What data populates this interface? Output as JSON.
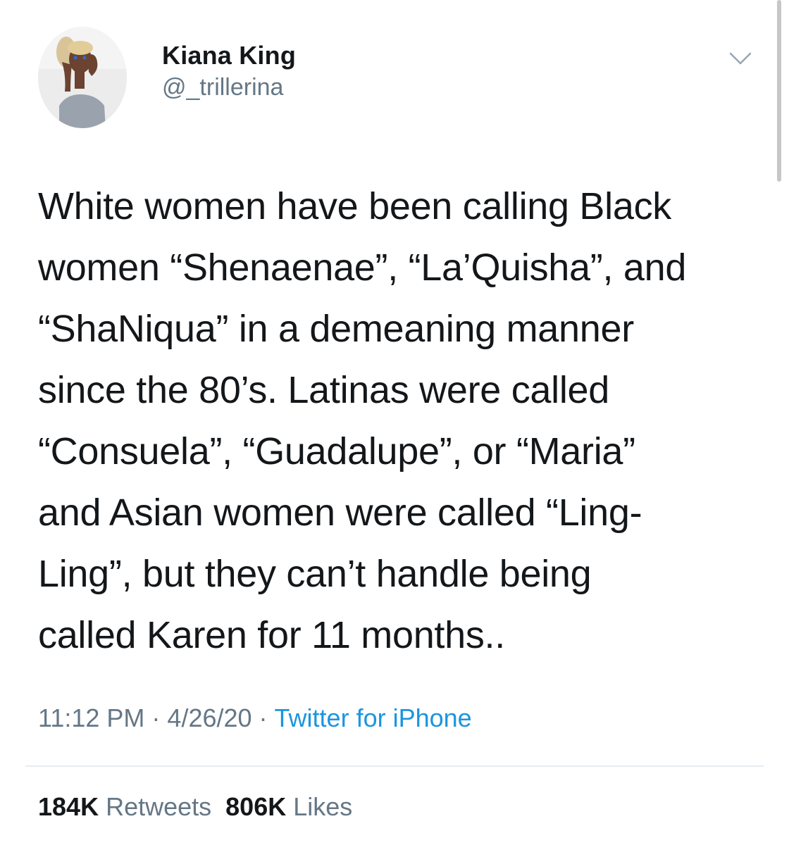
{
  "tweet": {
    "author": {
      "display_name": "Kiana King",
      "handle": "@_trillerina"
    },
    "text": "White women have been calling Black\nwomen “Shenaenae”, “La’Quisha”, and\n“ShaNiqua” in a demeaning manner\nsince the 80’s. Latinas were called\n“Consuela”, “Guadalupe”, or “Maria”\nand Asian women were called “Ling-\nLing”, but they can’t handle being\ncalled Karen for 11 months..",
    "time": "11:12 PM",
    "date": "4/26/20",
    "separator": "·",
    "source": "Twitter for iPhone",
    "stats": {
      "retweets_count": "184K",
      "retweets_label": "Retweets",
      "likes_count": "806K",
      "likes_label": "Likes"
    },
    "icons": {
      "menu": "chevron-down-icon"
    },
    "colors": {
      "text": "#14171a",
      "secondary": "#657786",
      "link": "#1b95e0",
      "divider": "#e6ecf0"
    }
  }
}
